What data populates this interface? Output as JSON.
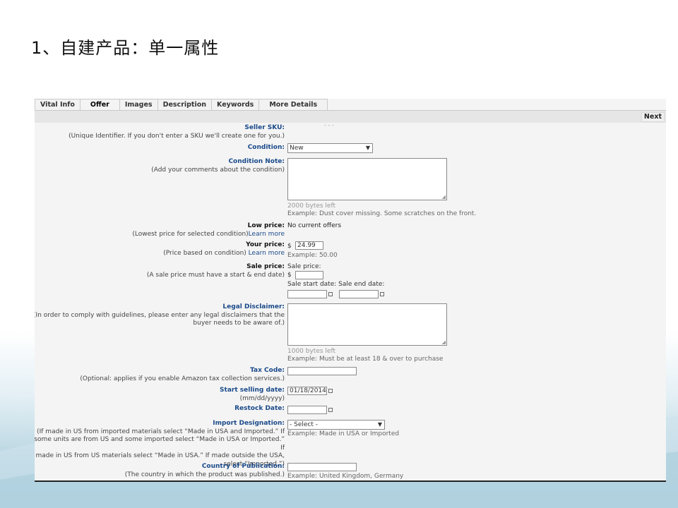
{
  "slide_title": "1、自建产品：单一属性",
  "tabs": [
    "Vital Info",
    "Offer",
    "Images",
    "Description",
    "Keywords",
    "More Details"
  ],
  "next_label": "Next",
  "sku": {
    "label": "Seller SKU:",
    "hint": "(Unique Identifier. If you don't enter a SKU we'll create one for you.)"
  },
  "condition": {
    "label": "Condition:",
    "value": "New"
  },
  "condition_note": {
    "label": "Condition Note:",
    "hint": "(Add your comments about the condition)",
    "bytes_left": "2000 bytes left",
    "example": "Example: Dust cover missing. Some scratches on the front."
  },
  "low_price": {
    "label": "Low price:",
    "hint": "(Lowest price for selected condition)",
    "link": "Learn more",
    "value": "No current offers"
  },
  "your_price": {
    "label": "Your price:",
    "hint": "(Price based on condition) ",
    "link": "Learn more",
    "currency": "$",
    "value": "24.99",
    "example": "Example: 50.00"
  },
  "sale_price": {
    "label": "Sale price:",
    "hint": "(A sale price must have a start & end date)",
    "sale_price_label": "Sale price:",
    "currency": "$",
    "start_label": "Sale start date:",
    "end_label": "Sale end date:"
  },
  "legal": {
    "label": "Legal Disclaimer:",
    "hint1": "(In order to comply with guidelines, please enter any legal disclaimers that the",
    "hint2": "buyer needs to be aware of.)",
    "bytes_left": "1000 bytes left",
    "example": "Example: Must be at least 18 & over to purchase"
  },
  "tax_code": {
    "label": "Tax Code:",
    "hint": "(Optional: applies if you enable Amazon tax collection services.)"
  },
  "start_selling": {
    "label": "Start selling date:",
    "hint": "(mm/dd/yyyy)",
    "value": "01/18/2014"
  },
  "restock": {
    "label": "Restock Date:"
  },
  "import": {
    "label": "Import Designation:",
    "hint1": "(If made in US from imported materials select “Made in USA and Imported.” If",
    "hint2": "some units are from US and some imported select “Made in USA or Imported.” If",
    "hint3": "made in US from US materials select “Made in USA.” If made outside the USA,",
    "hint4": "select “Imported.”)",
    "value": "- Select -",
    "example": "Example: Made in USA or Imported"
  },
  "country": {
    "label": "Country of Publication:",
    "hint": "(The country in which the product was published.)",
    "example": "Example: United Kingdom, Germany"
  }
}
